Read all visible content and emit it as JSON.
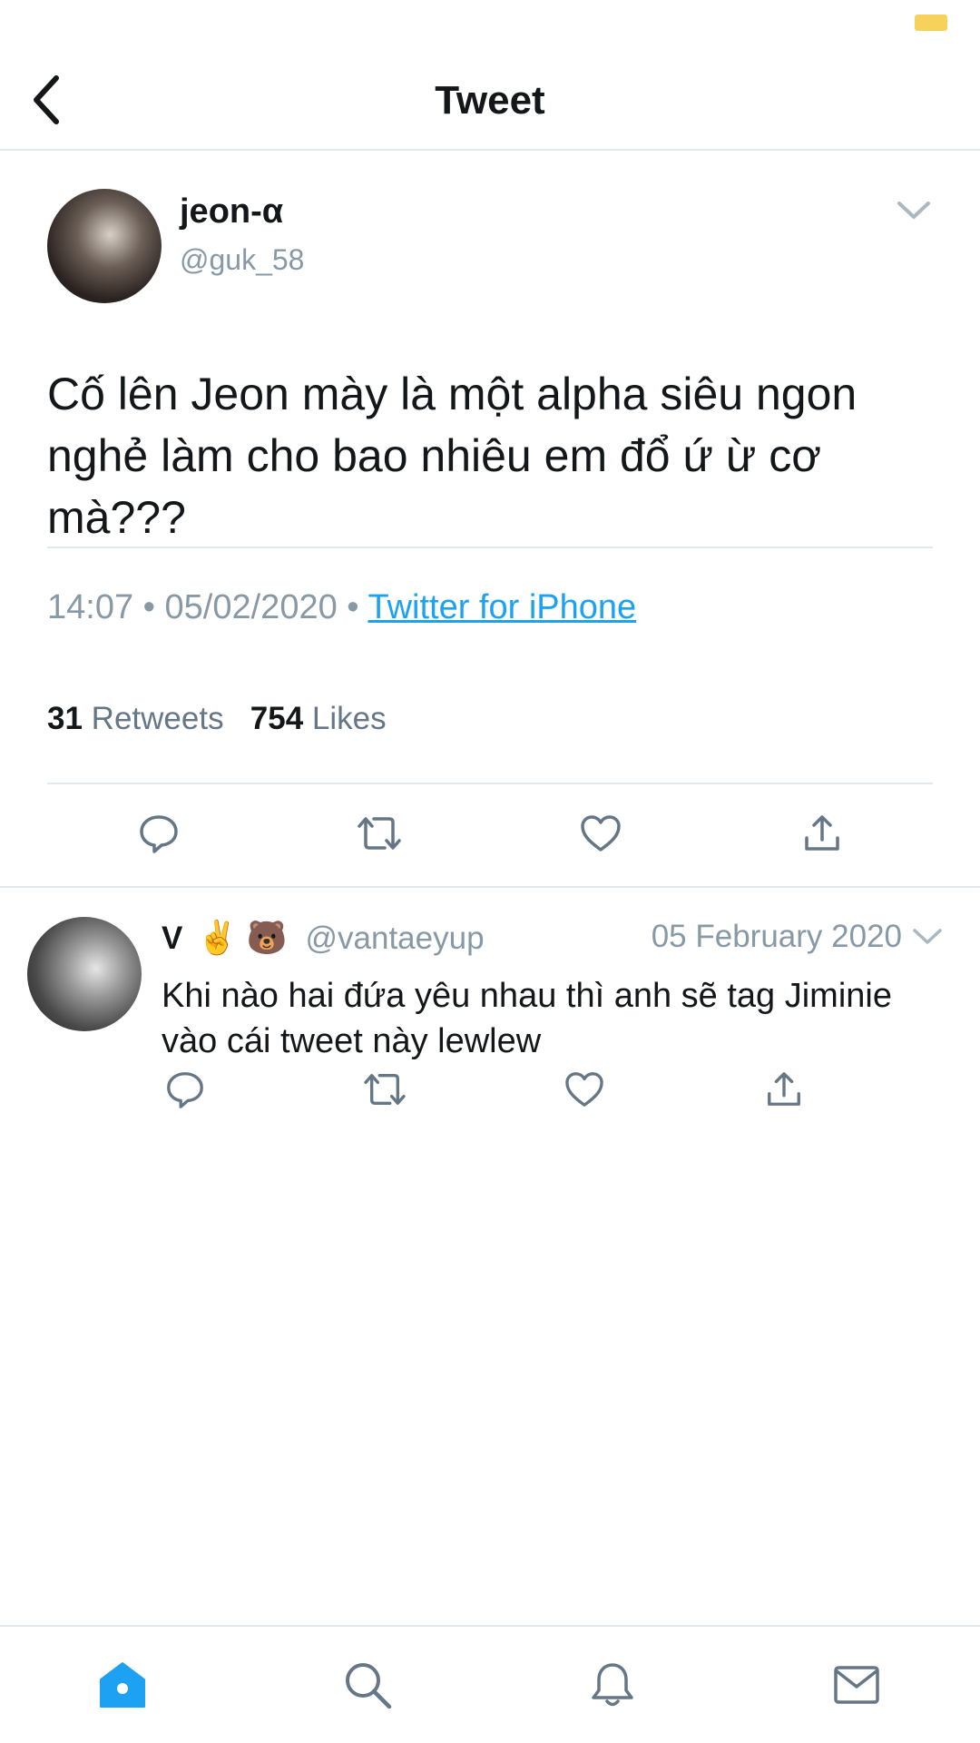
{
  "nav": {
    "title": "Tweet"
  },
  "main_tweet": {
    "display_name": "jeon-α",
    "handle": "@guk_58",
    "text": "Cố lên Jeon mày là một alpha siêu ngon nghẻ làm cho bao nhiêu em đổ ứ ừ cơ mà???",
    "time": "14:07",
    "date": "05/02/2020",
    "source": "Twitter for iPhone",
    "retweets_count": "31",
    "retweets_label": "Retweets",
    "likes_count": "754",
    "likes_label": "Likes"
  },
  "reply": {
    "display_name": "V",
    "emojis": "✌️ 🐻",
    "handle": "@vantaeyup",
    "date": "05 February 2020",
    "text": "Khi nào hai đứa yêu nhau thì anh sẽ tag Jiminie vào cái tweet này lewlew"
  },
  "icons": {
    "back": "chevron-left-icon",
    "reply": "speech-bubble-icon",
    "retweet": "retweet-icon",
    "like": "heart-icon",
    "share": "share-icon",
    "home": "home-icon",
    "search": "search-icon",
    "notifications": "bell-icon",
    "messages": "envelope-icon"
  },
  "colors": {
    "accent": "#1da1f2",
    "icon_gray": "#657786",
    "battery": "#f7d25a"
  }
}
